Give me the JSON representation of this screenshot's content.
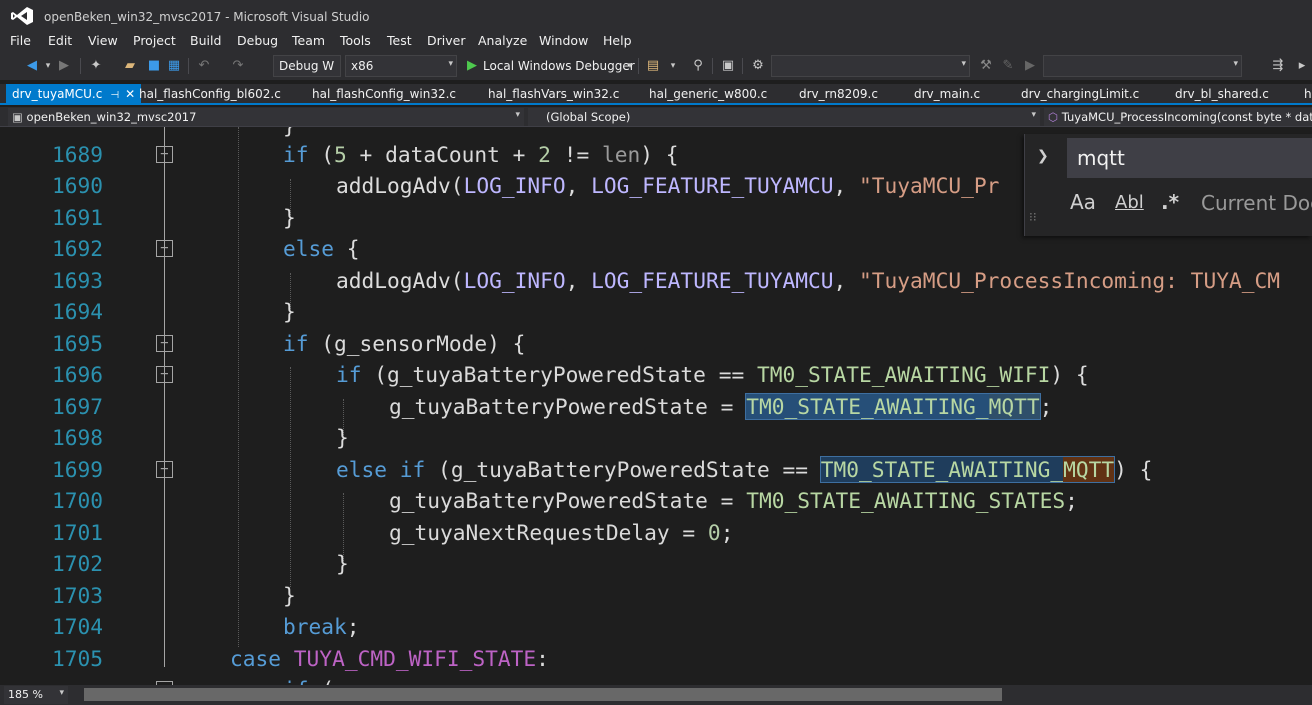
{
  "window": {
    "title": "openBeken_win32_mvsc2017 - Microsoft Visual Studio"
  },
  "menu": [
    "File",
    "Edit",
    "View",
    "Project",
    "Build",
    "Debug",
    "Team",
    "Tools",
    "Test",
    "Driver",
    "Analyze",
    "Window",
    "Help"
  ],
  "toolbar": {
    "config": "Debug W",
    "platform": "x86",
    "debugger": "Local Windows Debugger",
    "search_value": "",
    "right_combo_value": ""
  },
  "tabs": [
    {
      "label": "drv_tuyaMCU.c",
      "active": true
    },
    {
      "label": "hal_flashConfig_bl602.c"
    },
    {
      "label": "hal_flashConfig_win32.c"
    },
    {
      "label": "hal_flashVars_win32.c"
    },
    {
      "label": "hal_generic_w800.c"
    },
    {
      "label": "drv_rn8209.c"
    },
    {
      "label": "drv_main.c"
    },
    {
      "label": "drv_chargingLimit.c"
    },
    {
      "label": "drv_bl_shared.c"
    },
    {
      "label": "h"
    }
  ],
  "nav": {
    "project": "openBeken_win32_mvsc2017",
    "scope": "(Global Scope)",
    "function": "TuyaMCU_ProcessIncoming(const byte * data,"
  },
  "find": {
    "query": "mqtt",
    "match_case_glyph": "Aa",
    "whole_word_glyph": "Abl",
    "regex_glyph": ".*",
    "scope": "Current Doc"
  },
  "code": {
    "top_partial": "}",
    "lines": [
      {
        "n": "1689",
        "fold": true
      },
      {
        "n": "1690"
      },
      {
        "n": "1691"
      },
      {
        "n": "1692",
        "fold": true
      },
      {
        "n": "1693"
      },
      {
        "n": "1694"
      },
      {
        "n": "1695",
        "fold": true
      },
      {
        "n": "1696",
        "fold": true
      },
      {
        "n": "1697"
      },
      {
        "n": "1698"
      },
      {
        "n": "1699",
        "fold": true
      },
      {
        "n": "1700"
      },
      {
        "n": "1701"
      },
      {
        "n": "1702"
      },
      {
        "n": "1703"
      },
      {
        "n": "1704"
      },
      {
        "n": "1705"
      }
    ],
    "t": {
      "if": "if",
      "else": "else",
      "else_if": "else if",
      "break": "break",
      "case": "case",
      "addLogAdv": "addLogAdv(",
      "LOG_INFO": "LOG_INFO",
      "LOG_FEATURE": "LOG_FEATURE_TUYAMCU",
      "str1690": "\"TuyaMCU_Pr",
      "str1693": "\"TuyaMCU_ProcessIncoming: TUYA_CM",
      "len": "len",
      "dataCount": "dataCount",
      "five": "5",
      "two": "2",
      "zero": "0",
      "g_sensorMode": "g_sensorMode",
      "g_state": "g_tuyaBatteryPoweredState",
      "g_delay": "g_tuyaNextRequestDelay",
      "wifi_state": "TM0_STATE_AWAITING_WIFI",
      "mqtt_prefix": "TM0_STATE_AWAITING_",
      "mqtt_suffix": "MQTT",
      "states_state": "TM0_STATE_AWAITING_STATES",
      "case_const": "TUYA_CMD_WIFI_STATE"
    }
  },
  "status": {
    "zoom": "185 %"
  }
}
